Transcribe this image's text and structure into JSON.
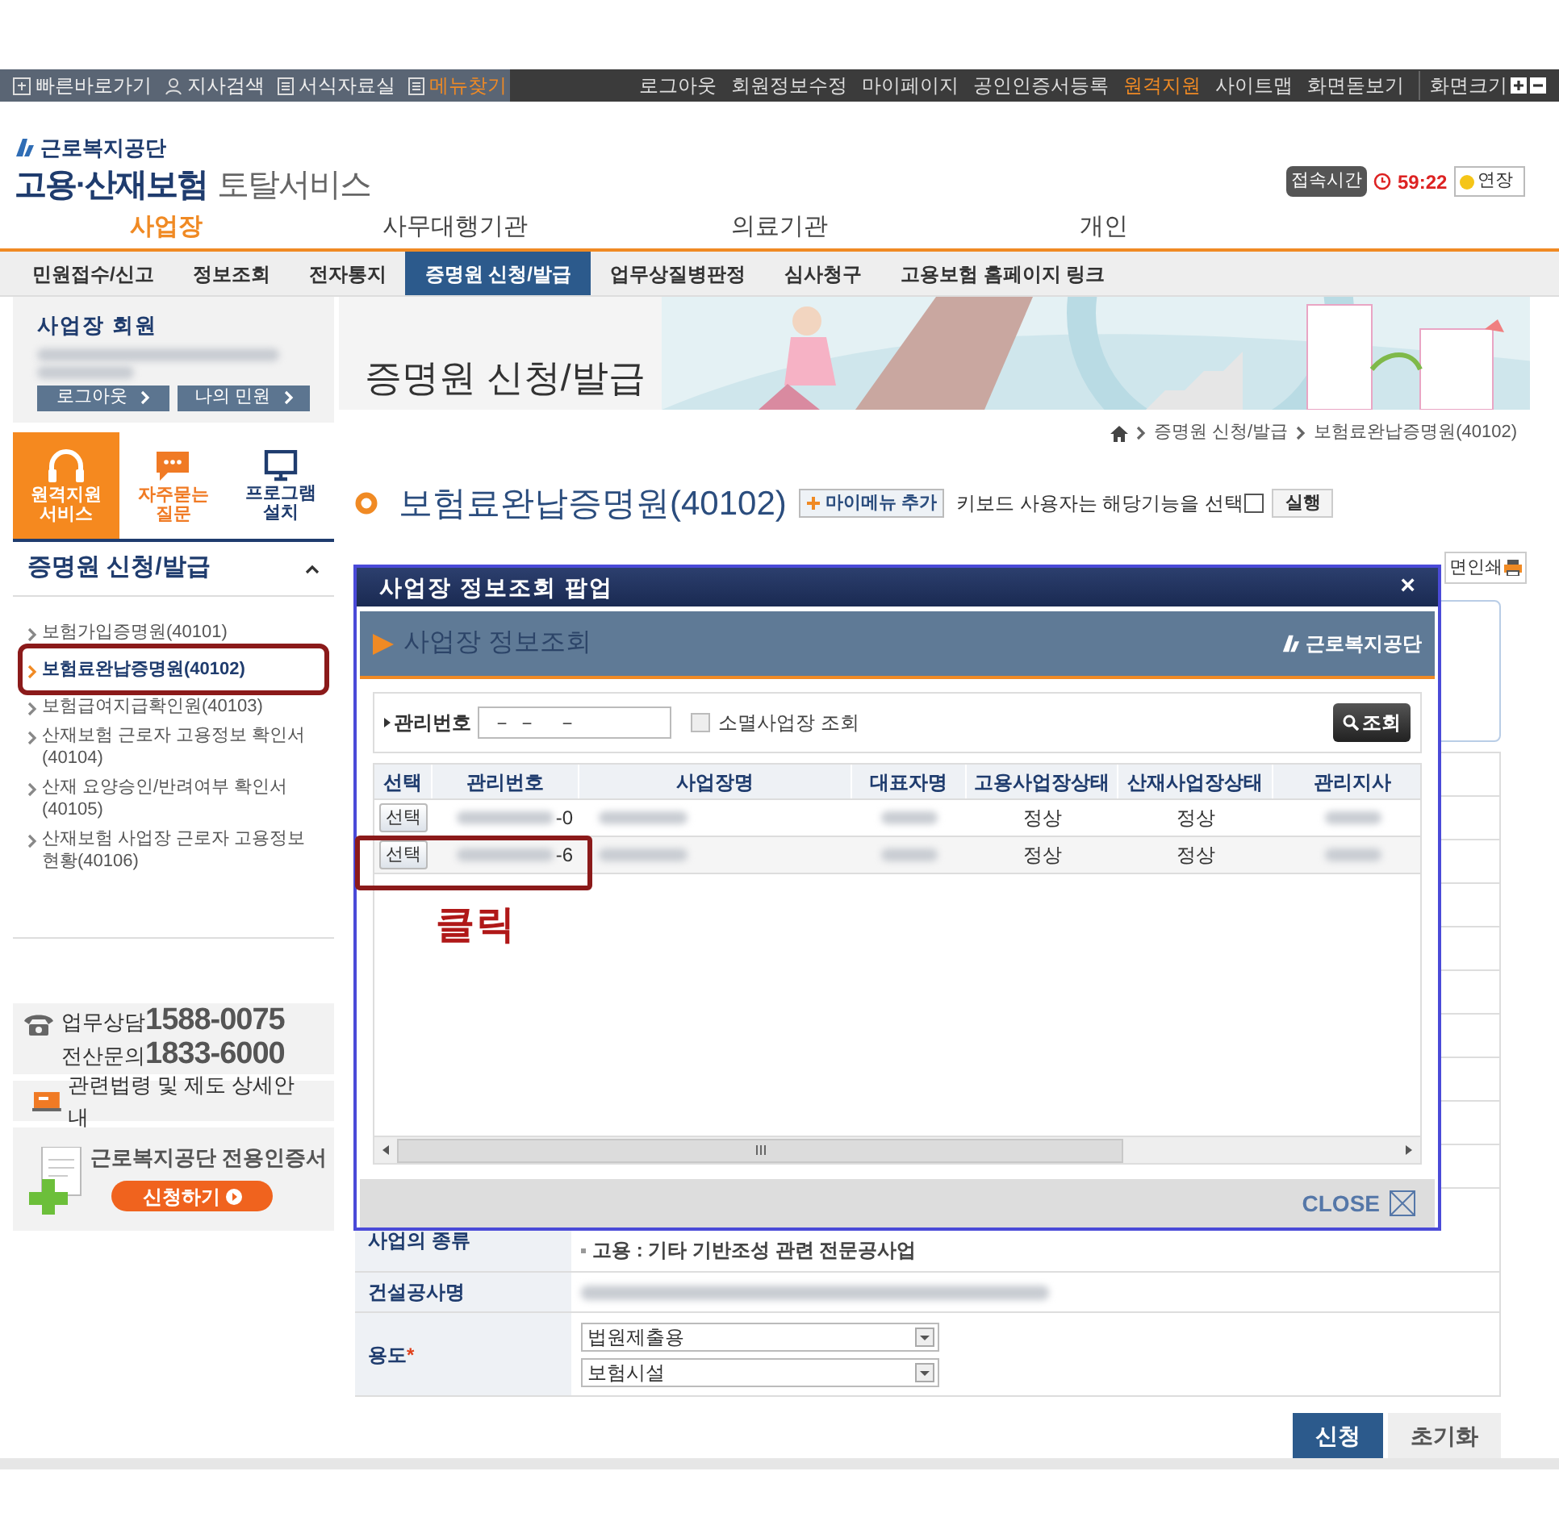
{
  "top_bar": {
    "left_links": [
      {
        "label": "빠른바로가기",
        "highlight": false
      },
      {
        "label": "지사검색",
        "highlight": false
      },
      {
        "label": "서식자료실",
        "highlight": false
      },
      {
        "label": "메뉴찾기",
        "highlight": true
      }
    ],
    "right_links": [
      {
        "label": "로그아웃",
        "highlight": false
      },
      {
        "label": "회원정보수정",
        "highlight": false
      },
      {
        "label": "마이페이지",
        "highlight": false
      },
      {
        "label": "공인인증서등록",
        "highlight": false
      },
      {
        "label": "원격지원",
        "highlight": true
      },
      {
        "label": "사이트맵",
        "highlight": false
      },
      {
        "label": "화면돋보기",
        "highlight": false
      }
    ],
    "screen_size": "화면크기"
  },
  "header": {
    "org": "근로복지공단",
    "service_bold": "고용·산재보험",
    "service_rest": "토탈서비스",
    "session_label": "접속시간",
    "session_time": "59:22",
    "extend_button": "연장"
  },
  "main_nav": [
    {
      "label": "사업장",
      "selected": true
    },
    {
      "label": "사무대행기관",
      "selected": false
    },
    {
      "label": "의료기관",
      "selected": false
    },
    {
      "label": "개인",
      "selected": false
    }
  ],
  "sub_nav": [
    {
      "label": "민원접수/신고",
      "selected": false
    },
    {
      "label": "정보조회",
      "selected": false
    },
    {
      "label": "전자통지",
      "selected": false
    },
    {
      "label": "증명원 신청/발급",
      "selected": true
    },
    {
      "label": "업무상질병판정",
      "selected": false
    },
    {
      "label": "심사청구",
      "selected": false
    },
    {
      "label": "고용보험 홈페이지 링크",
      "selected": false
    }
  ],
  "sidebar": {
    "member_title": "사업장 회원",
    "member_buttons": [
      "로그아웃",
      "나의 민원"
    ],
    "quick_links": [
      {
        "kind": "remote",
        "lines": [
          "원격지원",
          "서비스"
        ],
        "selected": true
      },
      {
        "kind": "faq",
        "lines": [
          "자주묻는",
          "질문"
        ],
        "selected": false
      },
      {
        "kind": "install",
        "lines": [
          "프로그램",
          "설치"
        ],
        "selected": false
      }
    ],
    "menu_title": "증명원 신청/발급",
    "menu_expanded": true,
    "menu_items": [
      {
        "label": "보험가입증명원(40101)",
        "selected": false
      },
      {
        "label": "보험료완납증명원(40102)",
        "selected": true
      },
      {
        "label": "보험급여지급확인원(40103)",
        "selected": false
      },
      {
        "label": "산재보험 근로자 고용정보 확인서(40104)",
        "selected": false
      },
      {
        "label": "산재 요양승인/반려여부 확인서(40105)",
        "selected": false
      },
      {
        "label": "산재보험 사업장 근로자 고용정보 현황(40106)",
        "selected": false
      }
    ],
    "contact": [
      {
        "label": "업무상담",
        "number": "1588-0075"
      },
      {
        "label": "전산문의",
        "number": "1833-6000"
      }
    ],
    "law_link": "관련법령 및 제도 상세안내",
    "cert": {
      "title": "근로복지공단 전용인증서",
      "button": "신청하기"
    }
  },
  "banner_title": "증명원 신청/발급",
  "breadcrumb": [
    "증명원 신청/발급",
    "보험료완납증명원(40102)"
  ],
  "page_title": "보험료완납증명원(40102)",
  "my_menu_button": "마이메뉴 추가",
  "keyboard_label": "키보드 사용자는 해당기능을 선택",
  "keyboard_checked": false,
  "run_button": "실행",
  "print_button": "면인쇄",
  "form": [
    {
      "kind": "text",
      "label": "사업의 종류",
      "value": "고용 : 기타 기반조성 관련 전문공사업"
    },
    {
      "kind": "blurred",
      "label": "건설공사명"
    },
    {
      "kind": "selects",
      "label": "용도",
      "required_mark": "*",
      "values": [
        "법원제출용",
        "보험시설"
      ]
    }
  ],
  "form_buttons": [
    {
      "label": "신청",
      "primary": true
    },
    {
      "label": "초기화",
      "primary": false
    }
  ],
  "popup": {
    "title": "사업장 정보조회 팝업",
    "close_glyph": "×",
    "heading": "사업장 정보조회",
    "brand": "근로복지공단",
    "search_label": "관리번호",
    "search_value": "－ －    －",
    "closed_business_label": "소멸사업장 조회",
    "closed_business_checked": false,
    "search_button": "조회",
    "columns": [
      "선택",
      "관리번호",
      "사업장명",
      "대표자명",
      "고용사업장상태",
      "산재사업장상태",
      "관리지사"
    ],
    "rows": [
      {
        "cells": [
          {
            "kind": "button",
            "text": "선택"
          },
          {
            "kind": "partial",
            "text": "-0"
          },
          {
            "kind": "blurred"
          },
          {
            "kind": "blurred"
          },
          {
            "kind": "text",
            "text": "정상"
          },
          {
            "kind": "text",
            "text": "정상"
          },
          {
            "kind": "blurred"
          }
        ]
      },
      {
        "cells": [
          {
            "kind": "button",
            "text": "선택"
          },
          {
            "kind": "partial",
            "text": "-6"
          },
          {
            "kind": "blurred"
          },
          {
            "kind": "blurred"
          },
          {
            "kind": "text",
            "text": "정상"
          },
          {
            "kind": "text",
            "text": "정상"
          },
          {
            "kind": "blurred"
          }
        ]
      }
    ],
    "close_label": "CLOSE"
  },
  "annotation_label": "클릭"
}
